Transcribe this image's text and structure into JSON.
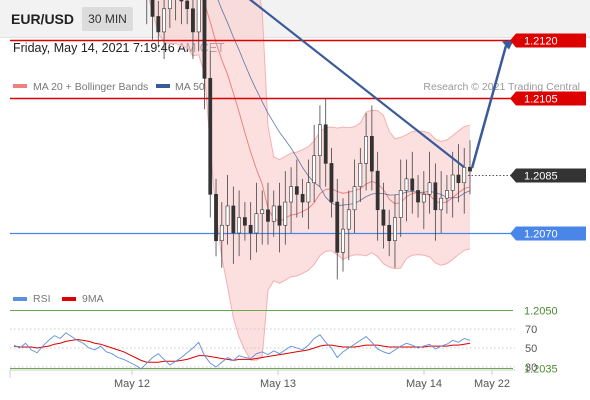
{
  "header": {
    "symbol": "EUR/USD",
    "timeframe": "30 MIN",
    "datetime": "Friday, May 14, 2021 7:19:46 AM CET"
  },
  "legend": {
    "items": [
      {
        "label": "MA 20 + Bollinger Bands",
        "color": "#f08080"
      },
      {
        "label": "MA 50",
        "color": "#3a5a9a"
      }
    ],
    "credit": "Research © 2021 Trading Central"
  },
  "rsi_legend": {
    "items": [
      {
        "label": "RSI",
        "color": "#5b8fe0"
      },
      {
        "label": "9MA",
        "color": "#dd0000"
      }
    ]
  },
  "colors": {
    "resistance": "#dd0000",
    "pivot": "#4a86e8",
    "support": "#6aa84f",
    "current": "#333333",
    "trendline": "#3a5a9a"
  },
  "chart_data": [
    {
      "type": "candlestick",
      "price_axis_labels": [
        "1.2120",
        "1.2105",
        "1.2085",
        "1.2070",
        "1.2050",
        "1.2035"
      ],
      "levels": [
        {
          "label": "1.2120",
          "value": 1.212,
          "kind": "resistance"
        },
        {
          "label": "1.2105",
          "value": 1.2105,
          "kind": "resistance"
        },
        {
          "label": "1.2085",
          "value": 1.2085,
          "kind": "current"
        },
        {
          "label": "1.2070",
          "value": 1.207,
          "kind": "pivot"
        },
        {
          "label": "1.2050",
          "value": 1.205,
          "kind": "support"
        },
        {
          "label": "1.2035",
          "value": 1.2035,
          "kind": "support"
        }
      ],
      "close_path": [
        1.2153,
        1.215,
        1.2148,
        1.2152,
        1.2146,
        1.214,
        1.2152,
        1.2162,
        1.2168,
        1.216,
        1.217,
        1.2165,
        1.2162,
        1.2158,
        1.2155,
        1.2153,
        1.2151,
        1.2149,
        1.2152,
        1.2147,
        1.2145,
        1.2142,
        1.2138,
        1.2132,
        1.2126,
        1.2122,
        1.2128,
        1.2133,
        1.2136,
        1.213,
        1.2128,
        1.2122,
        1.2148,
        1.211,
        1.208,
        1.2068,
        1.2072,
        1.2077,
        1.207,
        1.2074,
        1.2072,
        1.207,
        1.2075,
        1.2076,
        1.2073,
        1.2077,
        1.2072,
        1.2078,
        1.2082,
        1.208,
        1.2078,
        1.2083,
        1.209,
        1.2098,
        1.2088,
        1.2078,
        1.2065,
        1.2071,
        1.2076,
        1.2082,
        1.2088,
        1.2095,
        1.2086,
        1.2076,
        1.2072,
        1.2068,
        1.2074,
        1.2081,
        1.2084,
        1.2081,
        1.2078,
        1.208,
        1.2083,
        1.2076,
        1.2079,
        1.2081,
        1.2085,
        1.2083,
        1.2087,
        1.2086
      ],
      "forecast_target": 1.212
    },
    {
      "type": "line",
      "title": "RSI",
      "ylim": [
        10,
        90
      ],
      "yticks": [
        70,
        50,
        30
      ],
      "series": [
        {
          "name": "RSI",
          "values": [
            53,
            50,
            55,
            48,
            45,
            52,
            58,
            63,
            60,
            66,
            62,
            58,
            55,
            50,
            48,
            52,
            46,
            44,
            40,
            38,
            35,
            32,
            28,
            34,
            40,
            44,
            38,
            32,
            36,
            40,
            45,
            50,
            56,
            42,
            34,
            30,
            35,
            40,
            37,
            42,
            40,
            39,
            44,
            46,
            43,
            47,
            44,
            48,
            52,
            50,
            48,
            53,
            60,
            64,
            56,
            50,
            40,
            46,
            50,
            54,
            58,
            62,
            56,
            49,
            46,
            44,
            48,
            52,
            55,
            53,
            50,
            52,
            54,
            49,
            52,
            54,
            58,
            56,
            60,
            58
          ]
        },
        {
          "name": "9MA",
          "values": [
            52,
            51,
            51,
            51,
            50,
            51,
            52,
            54,
            55,
            57,
            58,
            59,
            58,
            57,
            55,
            54,
            52,
            50,
            48,
            46,
            43,
            40,
            37,
            35,
            35,
            35,
            36,
            36,
            36,
            37,
            38,
            40,
            42,
            42,
            41,
            40,
            39,
            38,
            37,
            38,
            38,
            38,
            39,
            40,
            41,
            42,
            43,
            44,
            45,
            46,
            47,
            48,
            50,
            52,
            53,
            53,
            52,
            51,
            51,
            51,
            52,
            53,
            53,
            53,
            52,
            51,
            51,
            51,
            51,
            51,
            51,
            51,
            52,
            52,
            52,
            52,
            53,
            53,
            54,
            55
          ]
        }
      ]
    }
  ],
  "x_axis": {
    "labels": [
      "May 12",
      "May 13",
      "May 14",
      "May 22"
    ]
  }
}
